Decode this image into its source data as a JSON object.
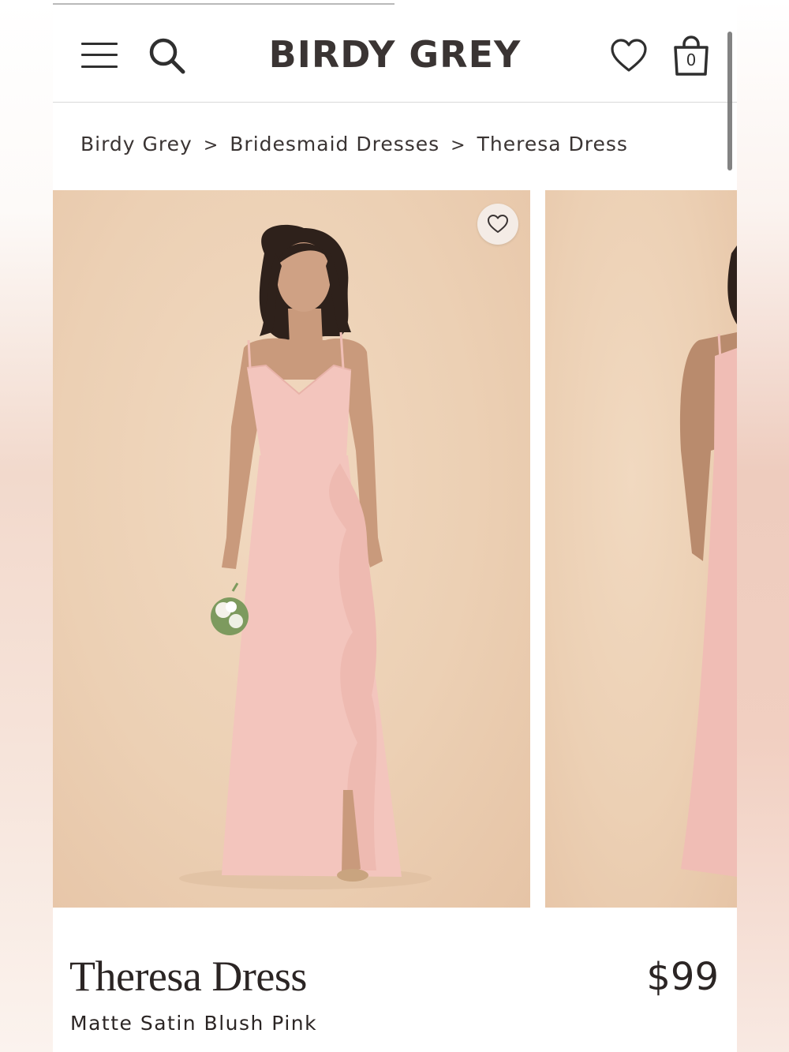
{
  "header": {
    "logo": "BIRDY GREY",
    "bag_count": "0",
    "icons": [
      "menu-icon",
      "search-icon",
      "heart-icon",
      "shopping-bag-icon"
    ]
  },
  "breadcrumb": [
    {
      "label": "Birdy Grey"
    },
    {
      "label": "Bridesmaid Dresses"
    },
    {
      "label": "Theresa Dress"
    }
  ],
  "breadcrumb_separator": ">",
  "gallery": {
    "favorite_icon": "heart-outline-icon",
    "colors": {
      "backdrop": "#ecd0b4",
      "dress": "#f3c5bd"
    }
  },
  "product": {
    "title": "Theresa Dress",
    "subtitle": "Matte Satin Blush Pink",
    "price": "$99"
  }
}
